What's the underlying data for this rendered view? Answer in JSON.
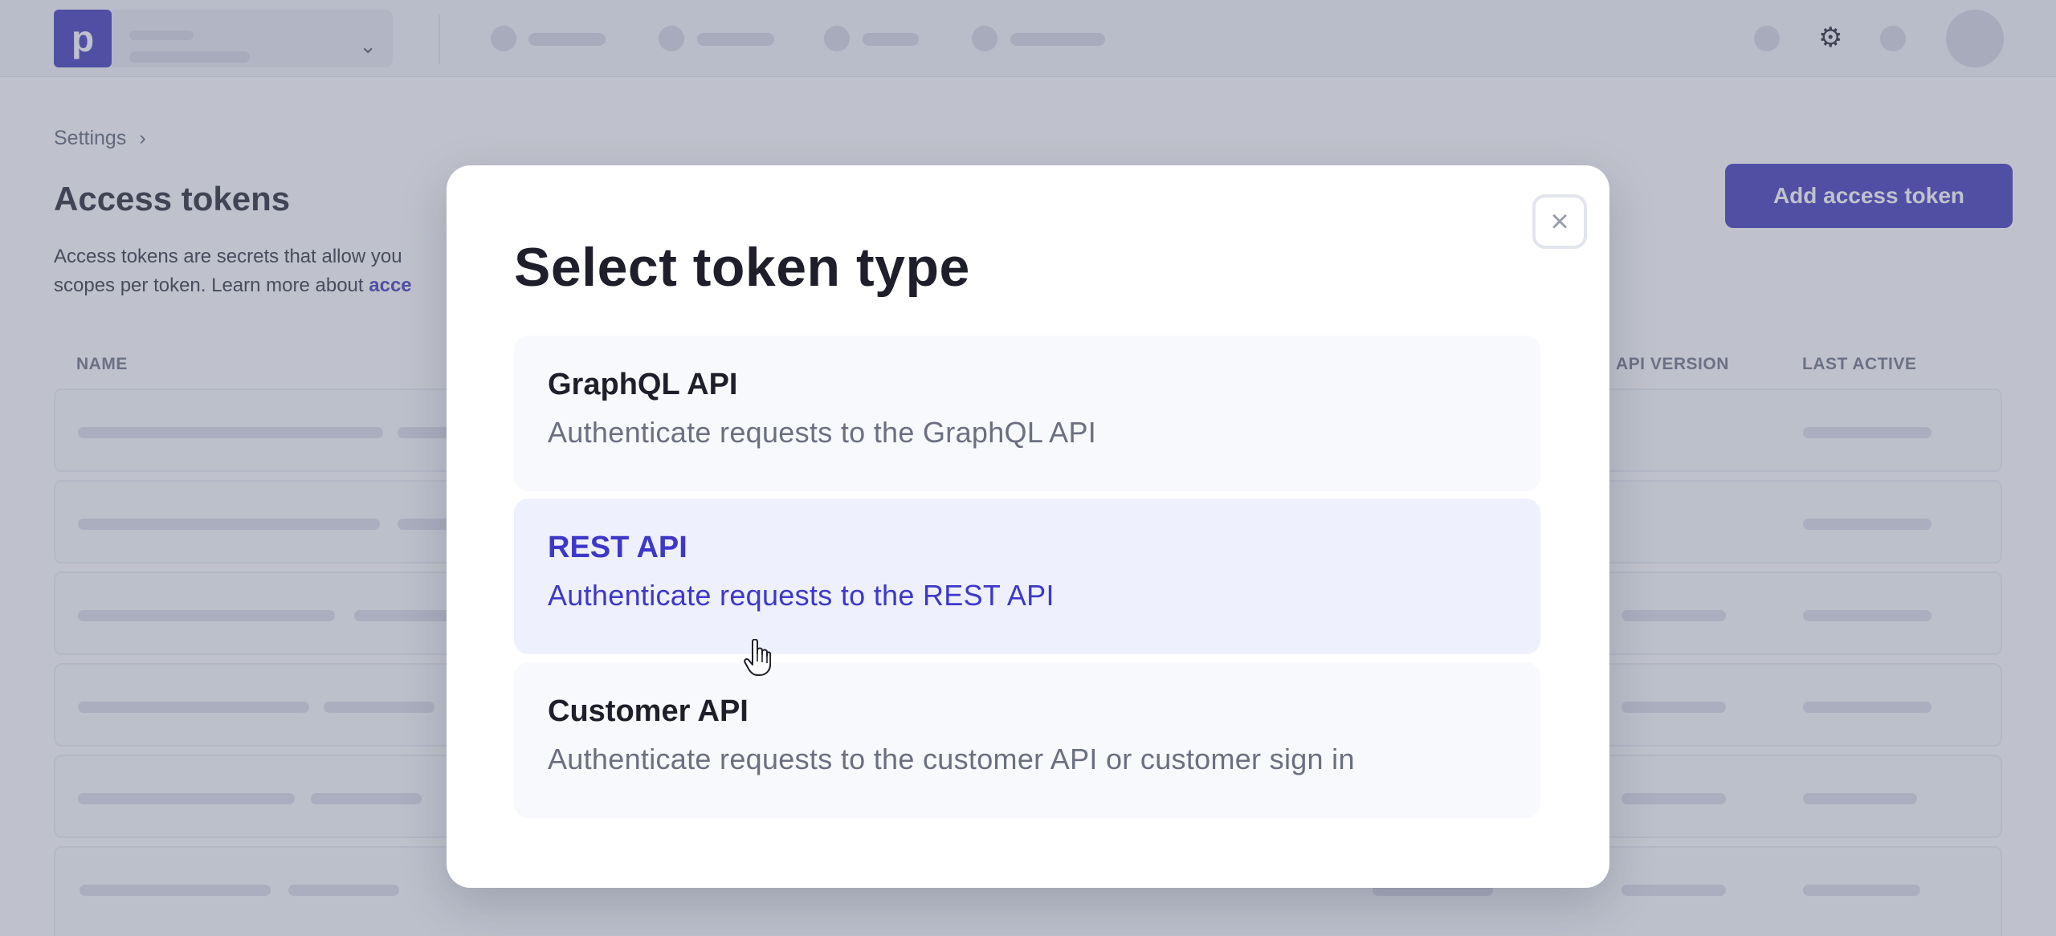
{
  "topbar": {
    "logo_letter": "p",
    "store_chevron": "⌄",
    "settings_icon": "⚙"
  },
  "breadcrumb": {
    "items": [
      "Settings"
    ],
    "separator": "›"
  },
  "page": {
    "title": "Access tokens",
    "description_line1": "Access tokens are secrets that allow you",
    "description_line2_prefix": "scopes per token. Learn more about ",
    "description_link": "acce",
    "add_button_label": "Add access token"
  },
  "table": {
    "columns": [
      "NAME",
      "API VERSION",
      "LAST ACTIVE"
    ]
  },
  "modal": {
    "title": "Select token type",
    "close_glyph": "×",
    "options": [
      {
        "title": "GraphQL API",
        "description": "Authenticate requests to the GraphQL API",
        "active": false
      },
      {
        "title": "REST API",
        "description": "Authenticate requests to the REST API",
        "active": true
      },
      {
        "title": "Customer API",
        "description": "Authenticate requests to the customer API or customer sign in",
        "active": false
      }
    ]
  },
  "colors": {
    "brand": "#3a33b8",
    "active_option_text": "#3e38c9",
    "active_option_bg": "#eef0fd"
  }
}
